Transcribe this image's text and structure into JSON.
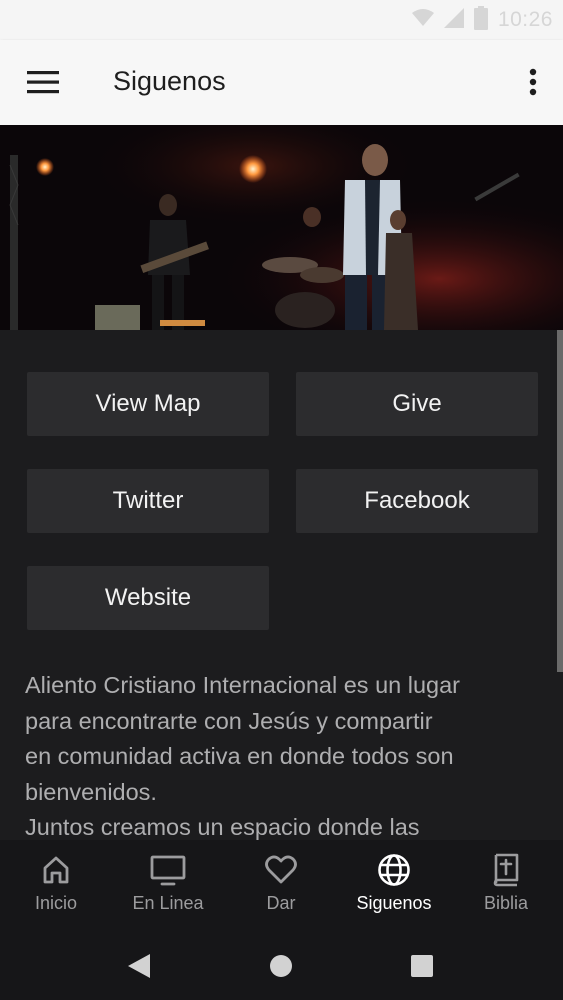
{
  "status_bar": {
    "time": "10:26",
    "icons": [
      "wifi-icon",
      "signal-icon",
      "battery-icon"
    ]
  },
  "app_bar": {
    "title": "Siguenos",
    "menu_icon": "hamburger-menu-icon",
    "overflow_icon": "more-vertical-icon"
  },
  "hero": {
    "image": "stage-worship-photo"
  },
  "buttons": {
    "view_map": "View Map",
    "give": "Give",
    "twitter": "Twitter",
    "facebook": "Facebook",
    "website": "Website"
  },
  "description": {
    "lines": [
      "Aliento Cristiano Internacional es un lugar",
      "para encontrarte con Jesús y compartir",
      "en comunidad activa en donde todos son",
      "bienvenidos.",
      "Juntos creamos un espacio donde las"
    ]
  },
  "bottom_nav": {
    "items": [
      {
        "label": "Inicio",
        "icon": "home-icon"
      },
      {
        "label": "En Linea",
        "icon": "tv-icon"
      },
      {
        "label": "Dar",
        "icon": "heart-icon"
      },
      {
        "label": "Siguenos",
        "icon": "globe-icon",
        "active": true
      },
      {
        "label": "Biblia",
        "icon": "bible-icon"
      }
    ]
  },
  "system_nav": {
    "icons": [
      "back-icon",
      "home-circle-icon",
      "recents-icon"
    ]
  },
  "colors": {
    "background": "#1c1c1e",
    "button": "#2c2c2e",
    "app_bar": "#f7f7f7",
    "active_tab": "#ffffff",
    "inactive_tab": "#9c9c9e"
  }
}
